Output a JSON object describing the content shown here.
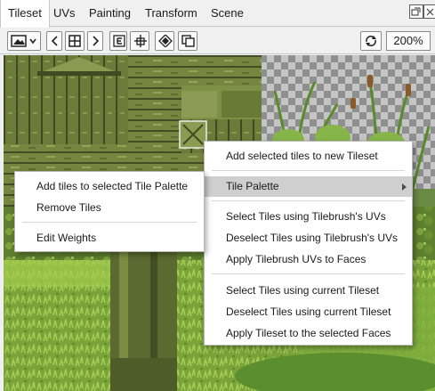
{
  "menubar": {
    "tabs": [
      {
        "label": "Tileset",
        "active": true
      },
      {
        "label": "UVs",
        "active": false
      },
      {
        "label": "Painting",
        "active": false
      },
      {
        "label": "Transform",
        "active": false
      },
      {
        "label": "Scene",
        "active": false
      }
    ],
    "window_buttons": [
      "restore-icon",
      "close-icon"
    ]
  },
  "toolbar": {
    "buttons": [
      "image-dropdown-icon",
      "prev-icon",
      "grid-icon",
      "next-icon",
      "edit-icon",
      "pivot-icon",
      "fill-icon",
      "copy-icon",
      "refresh-icon"
    ],
    "zoom": "200%"
  },
  "main_menu": {
    "items": [
      {
        "label": "Add selected tiles to new Tileset",
        "highlighted": false
      },
      {
        "label": "Tile Palette",
        "highlighted": true,
        "submenu": true
      },
      {
        "label": "Select Tiles using Tilebrush's UVs",
        "highlighted": false
      },
      {
        "label": "Deselect Tiles using Tilebrush's UVs",
        "highlighted": false
      },
      {
        "label": "Apply Tilebrush UVs to Faces",
        "highlighted": false
      },
      {
        "label": "Select Tiles using current Tileset",
        "highlighted": false
      },
      {
        "label": "Deselect Tiles using current Tileset",
        "highlighted": false
      },
      {
        "label": "Apply Tileset to the selected Faces",
        "highlighted": false
      }
    ]
  },
  "submenu": {
    "items": [
      {
        "label": "Add tiles to selected Tile Palette"
      },
      {
        "label": "Remove Tiles"
      },
      {
        "label": "Edit Weights"
      }
    ]
  },
  "colors": {
    "menu_highlight": "#cfcfcf",
    "wood_dark": "#4e5a2e",
    "wood_light": "#7a8a44",
    "grass": "#8fb84a",
    "selection": "#e8e8e8"
  }
}
